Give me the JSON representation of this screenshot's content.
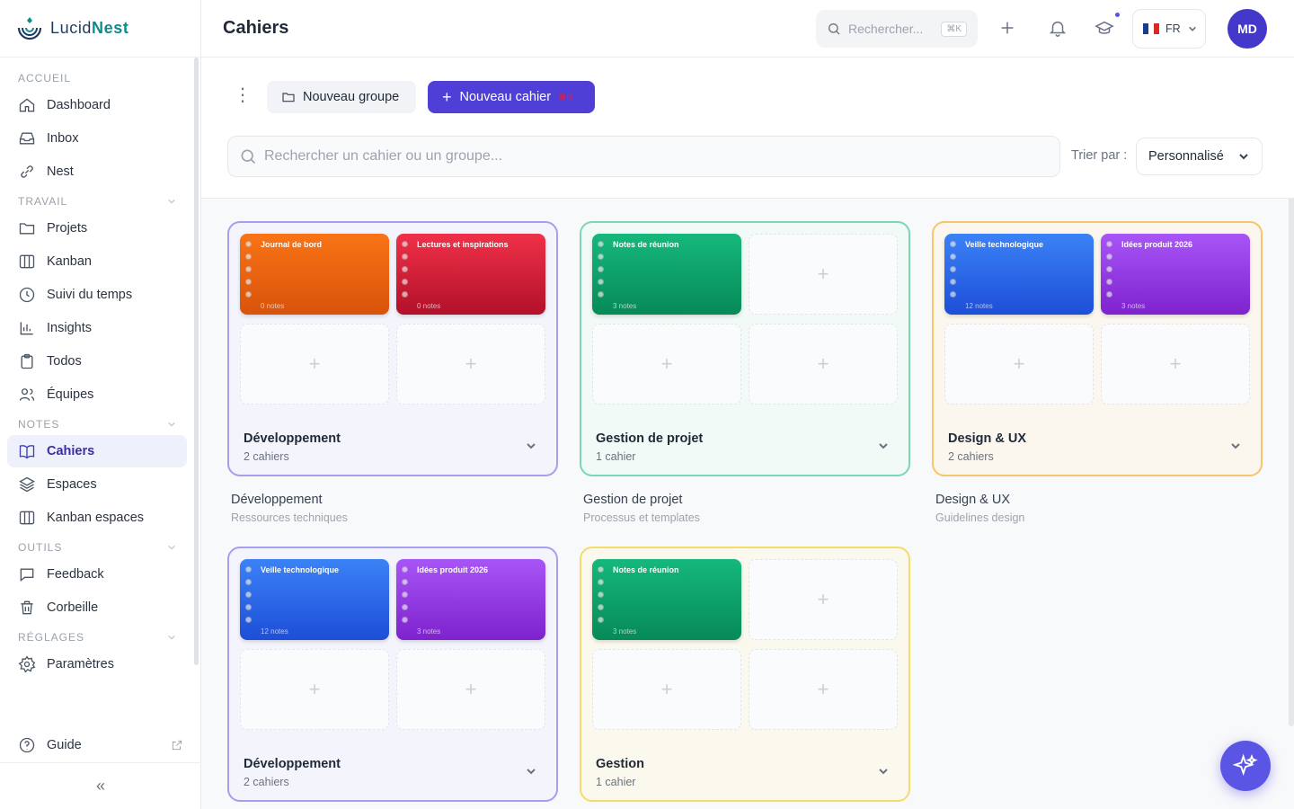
{
  "brand": {
    "name_part1": "Lucid",
    "name_part2": "Nest"
  },
  "sidebar": {
    "sections": [
      {
        "title": "ACCUEIL",
        "items": [
          {
            "label": "Dashboard",
            "icon": "home-icon"
          },
          {
            "label": "Inbox",
            "icon": "inbox-icon"
          },
          {
            "label": "Nest",
            "icon": "link-icon"
          }
        ]
      },
      {
        "title": "TRAVAIL",
        "items": [
          {
            "label": "Projets",
            "icon": "folder-icon"
          },
          {
            "label": "Kanban",
            "icon": "kanban-icon"
          },
          {
            "label": "Suivi du temps",
            "icon": "clock-icon"
          },
          {
            "label": "Insights",
            "icon": "chart-icon"
          },
          {
            "label": "Todos",
            "icon": "clipboard-icon"
          },
          {
            "label": "Équipes",
            "icon": "users-icon"
          }
        ]
      },
      {
        "title": "NOTES",
        "items": [
          {
            "label": "Cahiers",
            "icon": "book-icon",
            "active": true
          },
          {
            "label": "Espaces",
            "icon": "layers-icon"
          },
          {
            "label": "Kanban espaces",
            "icon": "kanban-icon"
          }
        ]
      },
      {
        "title": "OUTILS",
        "items": [
          {
            "label": "Feedback",
            "icon": "message-icon"
          },
          {
            "label": "Corbeille",
            "icon": "trash-icon"
          }
        ]
      },
      {
        "title": "RÉGLAGES",
        "items": [
          {
            "label": "Paramètres",
            "icon": "gear-icon"
          }
        ]
      }
    ],
    "guide_label": "Guide",
    "collapse_label": "«"
  },
  "header": {
    "title": "Cahiers",
    "search_placeholder": "Rechercher...",
    "search_shortcut": "⌘K",
    "lang": "FR",
    "avatar_initials": "MD"
  },
  "toolbar": {
    "new_group_label": "Nouveau groupe",
    "new_notebook_label": "Nouveau cahier",
    "new_notebook_shortcut": "⌘N",
    "search_placeholder": "Rechercher un cahier ou un groupe...",
    "sort_label": "Trier par :",
    "sort_value": "Personnalisé"
  },
  "groups": [
    {
      "name": "Développement",
      "count": "2 cahiers",
      "below_name": "Développement",
      "below_desc": "Ressources techniques",
      "notebooks": [
        {
          "title": "Journal de bord",
          "count": "0 notes",
          "color": "#f97316"
        },
        {
          "title": "Lectures et inspirations",
          "count": "0 notes",
          "color": "#e11d48"
        }
      ]
    },
    {
      "name": "Gestion de projet",
      "count": "1 cahier",
      "below_name": "Gestion de projet",
      "below_desc": "Processus et templates",
      "notebooks": [
        {
          "title": "Notes de réunion",
          "count": "3 notes",
          "color": "#10b981"
        }
      ]
    },
    {
      "name": "Design & UX",
      "count": "2 cahiers",
      "below_name": "Design & UX",
      "below_desc": "Guidelines design",
      "notebooks": [
        {
          "title": "Veille technologique",
          "count": "12 notes",
          "color": "#3b82f6"
        },
        {
          "title": "Idées produit 2026",
          "count": "3 notes",
          "color": "#a855f7"
        }
      ]
    },
    {
      "name": "Développement",
      "count": "2 cahiers",
      "notebooks": [
        {
          "title": "Veille technologique",
          "count": "12 notes",
          "color": "#3b82f6"
        },
        {
          "title": "Idées produit 2026",
          "count": "3 notes",
          "color": "#a855f7"
        }
      ]
    },
    {
      "name": "Gestion",
      "count": "1 cahier",
      "notebooks": [
        {
          "title": "Notes de réunion",
          "count": "3 notes",
          "color": "#10b981"
        }
      ]
    }
  ],
  "colors": {
    "accent": "#4f3fd6",
    "avatar": "#4338ca"
  }
}
